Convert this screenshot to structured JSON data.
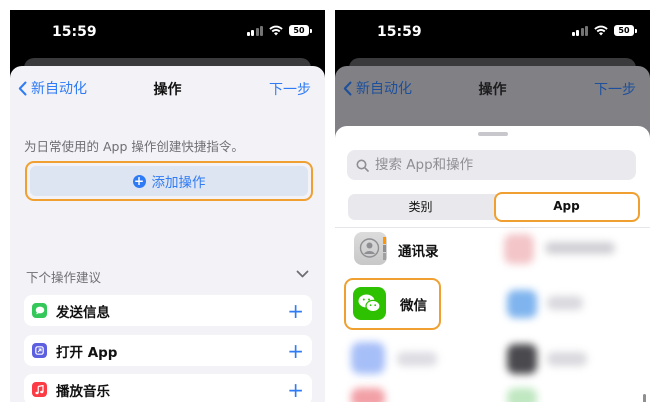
{
  "status": {
    "time": "15:59",
    "battery": "50"
  },
  "left": {
    "nav": {
      "back": "新自动化",
      "title": "操作",
      "next": "下一步"
    },
    "hint": "为日常使用的 App 操作创建快捷指令。",
    "add_action": "添加操作",
    "suggestions_title": "下个操作建议",
    "suggestions": [
      {
        "label": "发送信息",
        "icon": "messages-icon",
        "color": "#34c759"
      },
      {
        "label": "打开 App",
        "icon": "open-app-icon",
        "color": "#5b5fe0"
      },
      {
        "label": "播放音乐",
        "icon": "music-icon",
        "color": "#fc3c44"
      }
    ]
  },
  "right": {
    "nav": {
      "back": "新自动化",
      "title": "操作",
      "next": "下一步"
    },
    "search_placeholder": "搜索 App和操作",
    "segments": {
      "category": "类别",
      "app": "App"
    },
    "apps": [
      {
        "label": "通讯录",
        "icon": "contacts-icon"
      },
      {
        "label": "微信",
        "icon": "wechat-icon",
        "color": "#2dc100"
      }
    ]
  }
}
